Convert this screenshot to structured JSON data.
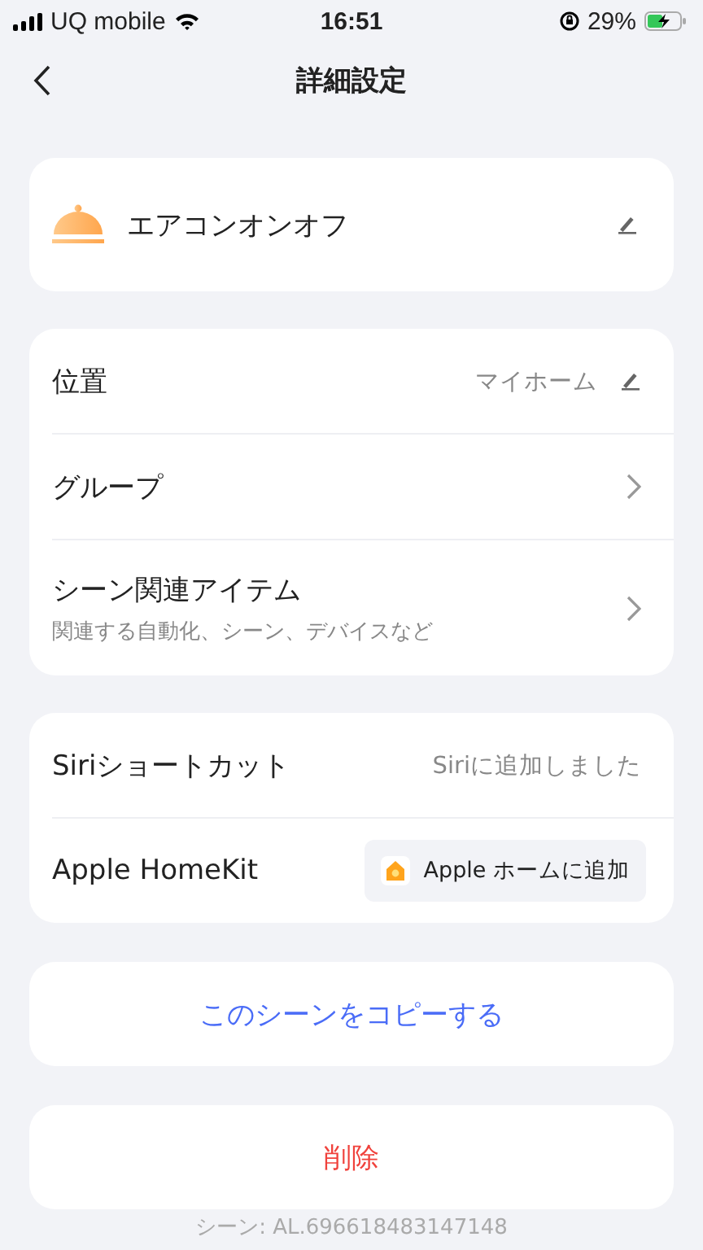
{
  "status_bar": {
    "carrier": "UQ mobile",
    "time": "16:51",
    "battery": "29%"
  },
  "header": {
    "title": "詳細設定"
  },
  "scene": {
    "name": "エアコンオンオフ"
  },
  "groups": [
    {
      "rows": [
        {
          "kind": "edit",
          "label": "位置",
          "value": "マイホーム"
        },
        {
          "kind": "link",
          "label": "グループ"
        },
        {
          "kind": "link",
          "label": "シーン関連アイテム",
          "subtitle": "関連する自動化、シーン、デバイスなど"
        }
      ]
    },
    {
      "rows": [
        {
          "kind": "value",
          "label": "Siriショートカット",
          "value": "Siriに追加しました"
        },
        {
          "kind": "button",
          "label": "Apple HomeKit",
          "value": "Apple ホームに追加"
        }
      ]
    }
  ],
  "actions": [
    {
      "kind": "copy",
      "label": "このシーンをコピーする"
    },
    {
      "kind": "delete",
      "label": "削除"
    }
  ],
  "footer": "シーン: AL.696618483147148"
}
